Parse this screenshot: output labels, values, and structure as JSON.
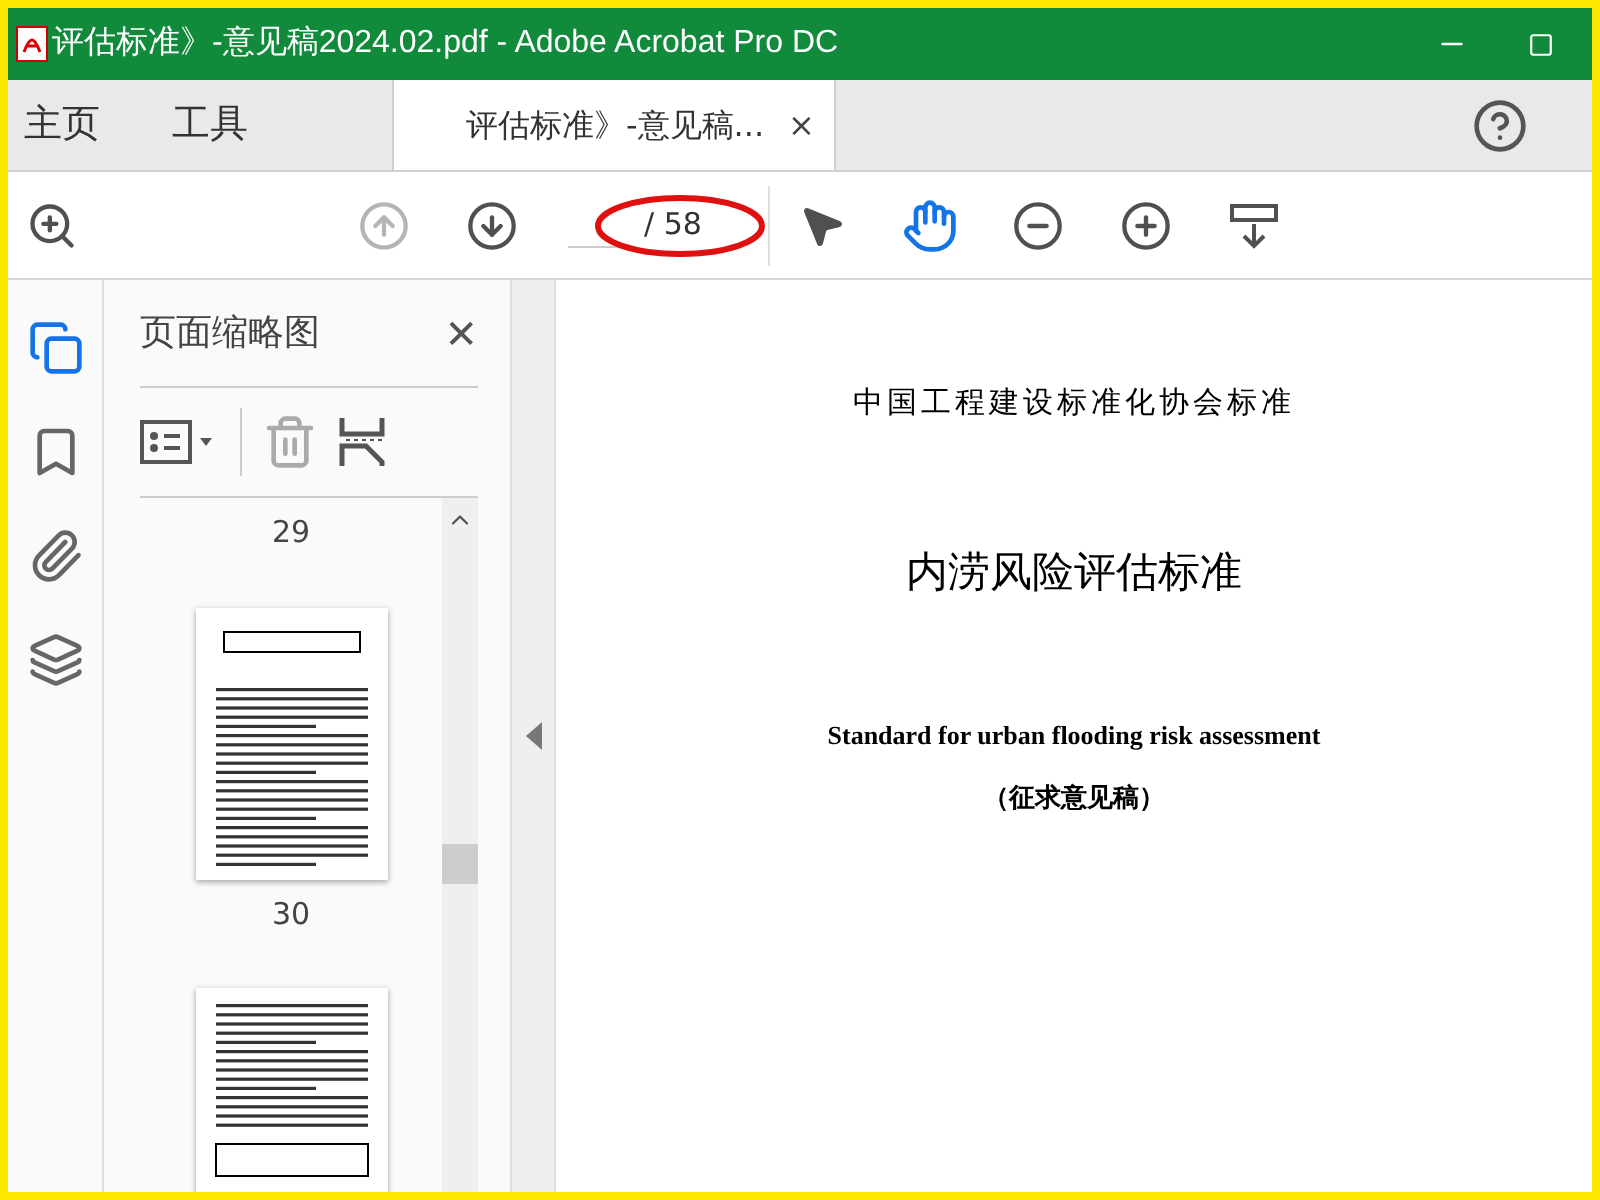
{
  "window": {
    "title": "评估标准》-意见稿2024.02.pdf - Adobe Acrobat Pro DC"
  },
  "tabs": [
    {
      "label": "主页",
      "kind": "nav",
      "selected": false
    },
    {
      "label": "工具",
      "kind": "nav",
      "selected": false
    },
    {
      "label": "评估标准》-意见稿...",
      "kind": "document",
      "selected": true,
      "close": "×"
    }
  ],
  "toolbar": {
    "page_total": "/ 58",
    "annotation_circle": true,
    "tools": [
      {
        "selected": false
      },
      {
        "selected": true
      }
    ]
  },
  "left_rail": [
    {
      "selected": true
    },
    {
      "selected": false
    },
    {
      "selected": false
    },
    {
      "selected": false
    }
  ],
  "thumbnails_panel": {
    "title": "页面缩略图",
    "close": "✕",
    "pages": [
      {
        "label": "29"
      },
      {
        "label": "30"
      }
    ]
  },
  "document": {
    "lines": [
      {
        "text": "中国工程建设标准化协会标准",
        "kind": "org"
      },
      {
        "text": "内涝风险评估标准",
        "kind": "title"
      },
      {
        "text": "Standard for urban flooding risk assessment",
        "kind": "english"
      },
      {
        "text": "（征求意见稿）",
        "kind": "subtitle"
      }
    ]
  }
}
